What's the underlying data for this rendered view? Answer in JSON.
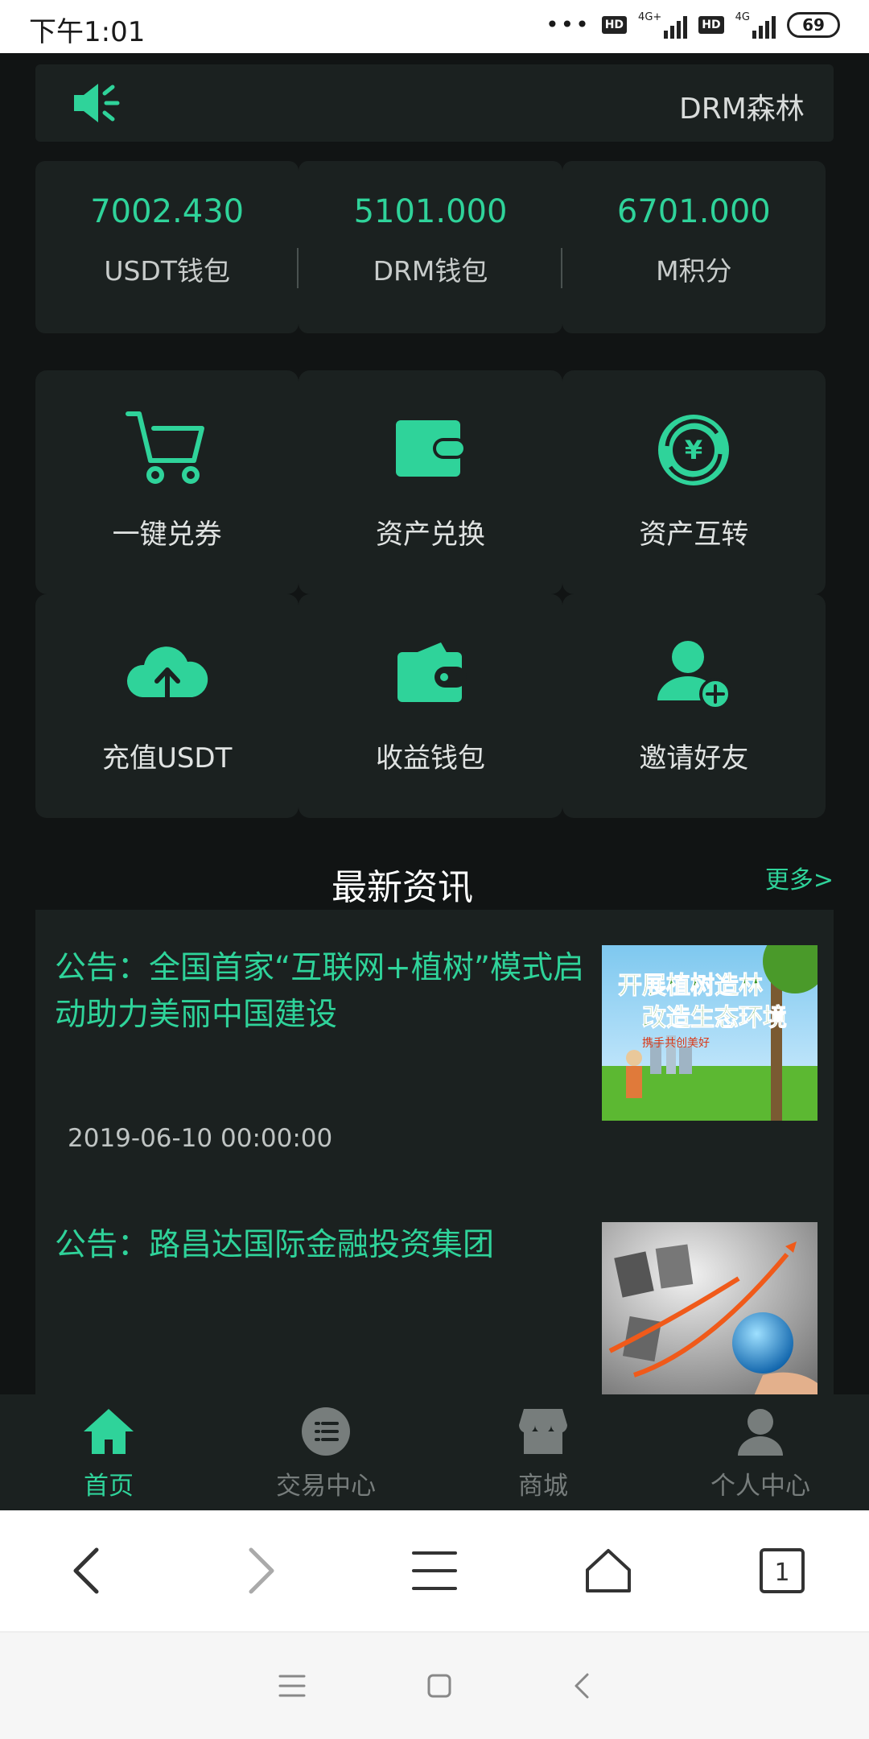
{
  "status_bar": {
    "time": "下午1:01",
    "network_1": "4G+",
    "network_2": "4G",
    "hd_label": "HD",
    "battery": "69"
  },
  "notice": {
    "text": "DRM森林"
  },
  "wallets": [
    {
      "value": "7002.430",
      "label": "USDT钱包"
    },
    {
      "value": "5101.000",
      "label": "DRM钱包"
    },
    {
      "value": "6701.000",
      "label": "M积分"
    }
  ],
  "actions": [
    {
      "label": "一键兑券",
      "icon": "cart-icon"
    },
    {
      "label": "资产兑换",
      "icon": "wallet-icon"
    },
    {
      "label": "资产互转",
      "icon": "yen-exchange-icon"
    },
    {
      "label": "充值USDT",
      "icon": "cloud-upload-icon"
    },
    {
      "label": "收益钱包",
      "icon": "wallet-open-icon"
    },
    {
      "label": "邀请好友",
      "icon": "add-user-icon"
    }
  ],
  "news": {
    "title": "最新资讯",
    "more": "更多>",
    "items": [
      {
        "title": "公告：全国首家“互联网+植树”模式启动助力美丽中国建设",
        "date": "2019-06-10 00:00:00",
        "thumb_text": "开展植树造林",
        "thumb_text2": "改造生态环境",
        "thumb_text3": "携手共创美好"
      },
      {
        "title": "公告：路昌达国际金融投资集团",
        "date": ""
      }
    ]
  },
  "tabs": [
    {
      "label": "首页",
      "icon": "home-icon",
      "active": true
    },
    {
      "label": "交易中心",
      "icon": "list-icon",
      "active": false
    },
    {
      "label": "商城",
      "icon": "store-icon",
      "active": false
    },
    {
      "label": "个人中心",
      "icon": "person-icon",
      "active": false
    }
  ],
  "browser_toolbar": {
    "tab_count": "1"
  },
  "colors": {
    "accent": "#2fd39a",
    "background": "#111414",
    "card": "#1b2120",
    "inactive": "#777d7c"
  }
}
